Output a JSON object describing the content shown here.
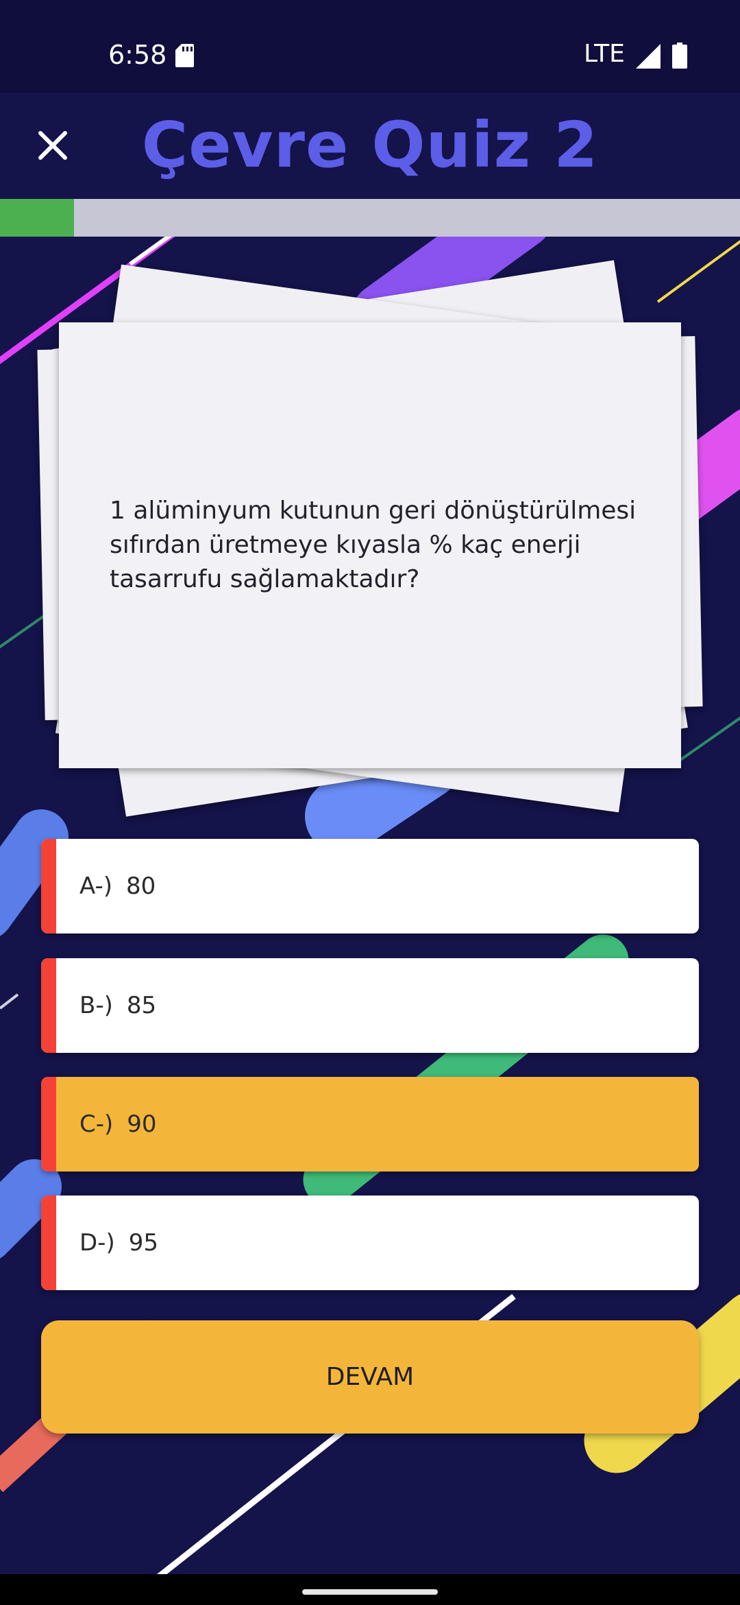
{
  "status_bar": {
    "time": "6:58",
    "network": "LTE",
    "icons": [
      "sd-card-icon",
      "signal-icon",
      "battery-icon"
    ]
  },
  "app_bar": {
    "title": "Çevre Quiz 2",
    "close_icon": "close-icon"
  },
  "progress": {
    "fraction": 0.1,
    "fill_color": "#4caf50",
    "track_color": "#c6c6d4"
  },
  "question": {
    "text": "1 alüminyum kutunun geri dönüştürülmesi sıfırdan üretmeye kıyasla % kaç enerji tasarrufu sağlamaktadır?"
  },
  "options": [
    {
      "letter": "A-)",
      "value": "80",
      "selected": false
    },
    {
      "letter": "B-)",
      "value": "85",
      "selected": false
    },
    {
      "letter": "C-)",
      "value": "90",
      "selected": true
    },
    {
      "letter": "D-)",
      "value": "95",
      "selected": false
    }
  ],
  "continue_button": {
    "label": "DEVAM"
  },
  "colors": {
    "background": "#14134a",
    "title": "#5c5ee8",
    "selected_option": "#f4b63a",
    "option_accent": "#f44336",
    "button": "#f4b63a"
  }
}
